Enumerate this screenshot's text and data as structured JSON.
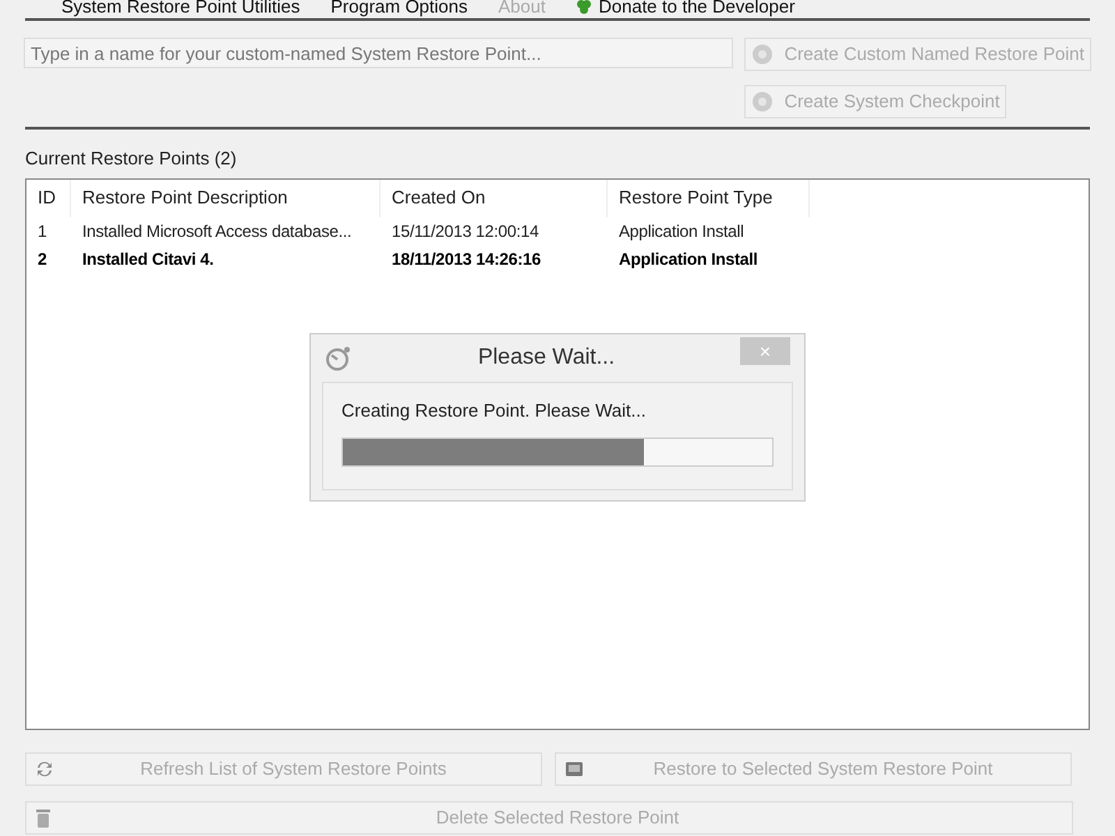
{
  "menu": [
    {
      "label": "System Restore Point Utilities",
      "disabled": false,
      "kind": "plain"
    },
    {
      "label": "Program Options",
      "disabled": false,
      "kind": "plain"
    },
    {
      "label": "About",
      "disabled": true,
      "kind": "plain"
    },
    {
      "label": "Donate to the Developer",
      "disabled": false,
      "kind": "donate"
    }
  ],
  "name_field": {
    "placeholder": "Type in a name for your custom-named System Restore Point..."
  },
  "create_buttons": [
    {
      "label": "Create Custom Named Restore Point",
      "disabled": true
    },
    {
      "label": "Create System Checkpoint",
      "disabled": true
    }
  ],
  "list_title": "Current Restore Points (2)",
  "table": {
    "columns": [
      "ID",
      "Restore Point Description",
      "Created On",
      "Restore Point Type"
    ],
    "rows": [
      {
        "cells": [
          "1",
          "Installed Microsoft Access database...",
          "15/11/2013 12:00:14",
          "Application Install"
        ],
        "bold": false
      },
      {
        "cells": [
          "2",
          "Installed Citavi 4.",
          "18/11/2013 14:26:16",
          "Application Install"
        ],
        "bold": true
      }
    ]
  },
  "dialog": {
    "title": "Please Wait...",
    "close": "×",
    "message": "Creating Restore Point.  Please Wait...",
    "level": 0.7
  },
  "bottom_buttons": [
    {
      "label": "Refresh List of System Restore Points",
      "kind": "refresh",
      "disabled": true
    },
    {
      "label": "Restore to Selected System Restore Point",
      "kind": "restore",
      "disabled": true
    },
    {
      "label": "Delete Selected Restore Point",
      "kind": "delete",
      "disabled": true
    }
  ]
}
